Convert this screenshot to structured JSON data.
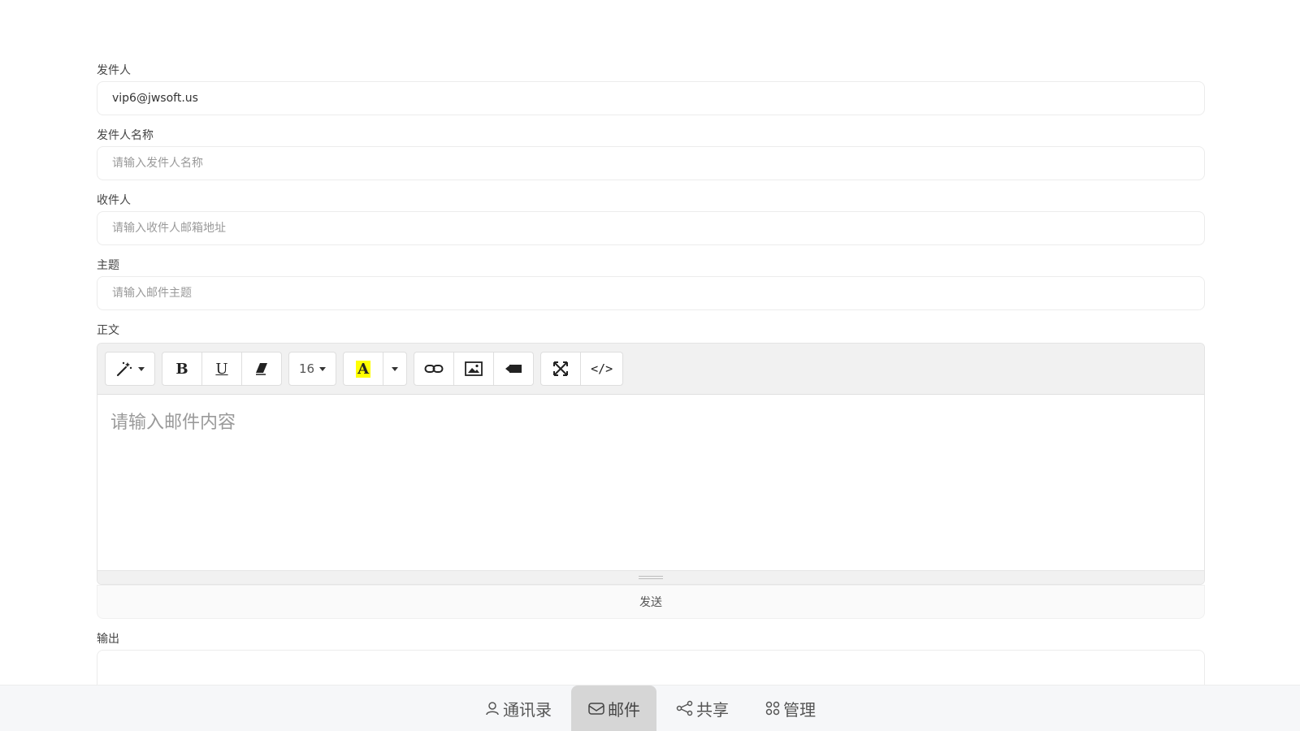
{
  "form": {
    "sender": {
      "label": "发件人",
      "value": "vip6@jwsoft.us",
      "placeholder": ""
    },
    "sender_name": {
      "label": "发件人名称",
      "value": "",
      "placeholder": "请输入发件人名称"
    },
    "recipient": {
      "label": "收件人",
      "value": "",
      "placeholder": "请输入收件人邮箱地址"
    },
    "subject": {
      "label": "主题",
      "value": "",
      "placeholder": "请输入邮件主题"
    },
    "body": {
      "label": "正文",
      "placeholder": "请输入邮件内容",
      "toolbar": {
        "style_icon": "magic-wand-icon",
        "bold": "B",
        "underline": "U",
        "clear_icon": "eraser-icon",
        "font_size": "16",
        "highlight": "A",
        "link_icon": "link-icon",
        "image_icon": "image-icon",
        "video_icon": "video-icon",
        "fullscreen_icon": "fullscreen-icon",
        "code": "</>"
      }
    },
    "send_label": "发送",
    "output_label": "输出"
  },
  "nav": [
    {
      "label": "通讯录",
      "icon": "user-icon",
      "active": false
    },
    {
      "label": "邮件",
      "icon": "mail-icon",
      "active": true
    },
    {
      "label": "共享",
      "icon": "share-icon",
      "active": false
    },
    {
      "label": "管理",
      "icon": "manage-icon",
      "active": false
    }
  ],
  "colors": {
    "highlight": "#ffff00",
    "active_tab": "#d6d6d6"
  }
}
